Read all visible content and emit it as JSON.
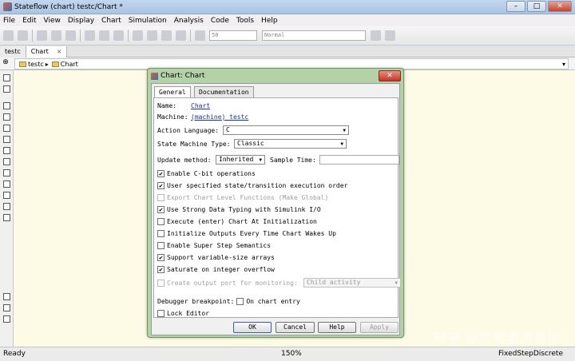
{
  "window": {
    "title": "Stateflow (chart) testc/Chart *",
    "buttons": [
      "–",
      "□",
      "✕"
    ]
  },
  "menu": [
    "File",
    "Edit",
    "View",
    "Display",
    "Chart",
    "Simulation",
    "Analysis",
    "Code",
    "Tools",
    "Help"
  ],
  "toolbar": {
    "stop_time": "50",
    "sim_mode": "Normal"
  },
  "tabs": [
    {
      "label": "testc"
    },
    {
      "label": "Chart",
      "close": "×"
    }
  ],
  "address": {
    "root": "testc",
    "separator": "▸",
    "child": "Chart",
    "dropdown": "▾"
  },
  "status": {
    "left": "Ready",
    "zoom": "150%",
    "solver": "FixedStepDiscrete"
  },
  "watermark": "知乎 @黑暗里的真实",
  "dialog": {
    "title": "Chart: Chart",
    "close": "✕",
    "tabs": [
      "General",
      "Documentation"
    ],
    "name_label": "Name:",
    "name_value": "Chart",
    "machine_label": "Machine:",
    "machine_value": "(machine) testc",
    "action_language_label": "Action Language:",
    "action_language_value": "C",
    "state_machine_type_label": "State Machine Type:",
    "state_machine_type_value": "Classic",
    "update_method_label": "Update method:",
    "update_method_value": "Inherited",
    "sample_time_label": "Sample Time:",
    "options": [
      {
        "label": "Enable C-bit operations",
        "checked": true,
        "enabled": true
      },
      {
        "label": "User specified state/transition execution order",
        "checked": true,
        "enabled": true
      },
      {
        "label": "Export Chart Level Functions (Make Global)",
        "checked": false,
        "enabled": false
      },
      {
        "label": "Use Strong Data Typing with Simulink I/O",
        "checked": true,
        "enabled": true
      },
      {
        "label": "Execute (enter) Chart At Initialization",
        "checked": false,
        "enabled": true
      },
      {
        "label": "Initialize Outputs Every Time Chart Wakes Up",
        "checked": false,
        "enabled": true
      },
      {
        "label": "Enable Super Step Semantics",
        "checked": false,
        "enabled": true
      },
      {
        "label": "Support variable-size arrays",
        "checked": true,
        "enabled": true
      },
      {
        "label": "Saturate on integer overflow",
        "checked": true,
        "enabled": true
      }
    ],
    "output_port_label": "Create output port for monitoring:",
    "output_port_value": "Child activity",
    "debugger_label": "Debugger breakpoint:",
    "debugger_option": "On chart entry",
    "lock_editor": "Lock Editor",
    "buttons": {
      "ok": "OK",
      "cancel": "Cancel",
      "help": "Help",
      "apply": "Apply"
    },
    "check_mark": "✔"
  }
}
